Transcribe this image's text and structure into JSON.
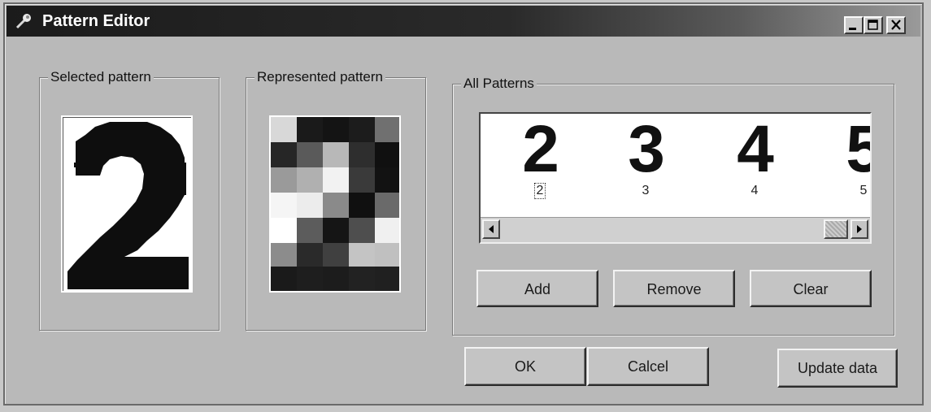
{
  "window": {
    "title": "Pattern Editor"
  },
  "groups": {
    "selected_label": "Selected pattern",
    "represented_label": "Represented pattern",
    "all_label": "All Patterns"
  },
  "patterns": [
    {
      "digit": "2",
      "label": "2",
      "selected": true
    },
    {
      "digit": "3",
      "label": "3",
      "selected": false
    },
    {
      "digit": "4",
      "label": "4",
      "selected": false
    },
    {
      "digit": "5",
      "label": "5",
      "selected": false
    }
  ],
  "buttons": {
    "add": "Add",
    "remove": "Remove",
    "clear": "Clear",
    "ok": "OK",
    "cancel": "Calcel",
    "update": "Update data"
  },
  "colors": {
    "titlebar": "#1b1b1b",
    "face": "#b9b9b9",
    "window_bg": "#ffffff"
  }
}
